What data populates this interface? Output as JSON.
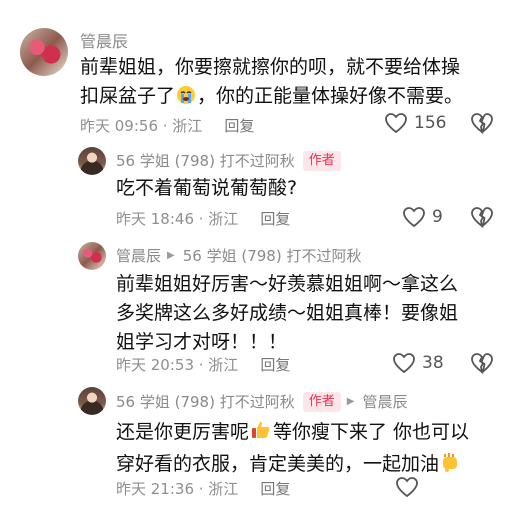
{
  "comments": [
    {
      "name": "管晨辰",
      "text_a": "前辈姐姐，你要擦就擦你的呗，就不要给体操",
      "text_b": "扣屎盆子了",
      "text_c": "，你的正能量体操好像不需要。",
      "emoji": "crying-face",
      "time": "昨天 09:56 · 浙江",
      "reply": "回复",
      "likes": "156"
    },
    {
      "name": "56 学姐 (798) 打不过阿秋",
      "badge": "作者",
      "text": "吃不着葡萄说葡萄酸?",
      "time": "昨天 18:46 · 浙江",
      "reply": "回复",
      "likes": "9"
    },
    {
      "name": "管晨辰",
      "target": "56 学姐 (798) 打不过阿秋",
      "text_1": "前辈姐姐好厉害～好羡慕姐姐啊～拿这么",
      "text_2": "多奖牌这么多好成绩～姐姐真棒！要像姐",
      "text_3": "姐学习才对呀！！！",
      "time": "昨天 20:53 · 浙江",
      "reply": "回复",
      "likes": "38"
    },
    {
      "name": "56 学姐 (798) 打不过阿秋",
      "badge": "作者",
      "target": "管晨辰",
      "text_1a": "还是你更厉害呢",
      "text_1b": "等你瘦下来了 你也可以",
      "text_2a": "穿好看的衣服，肯定美美的，一起加油",
      "emoji1": "thumbs-up",
      "emoji2": "fist",
      "time": "昨天 21:36 · 浙江",
      "reply": "回复",
      "likes": ""
    }
  ],
  "colors": {
    "badge_bg": "#fde6ea",
    "badge_text": "#e8344f",
    "meta": "#8f8f8f"
  }
}
